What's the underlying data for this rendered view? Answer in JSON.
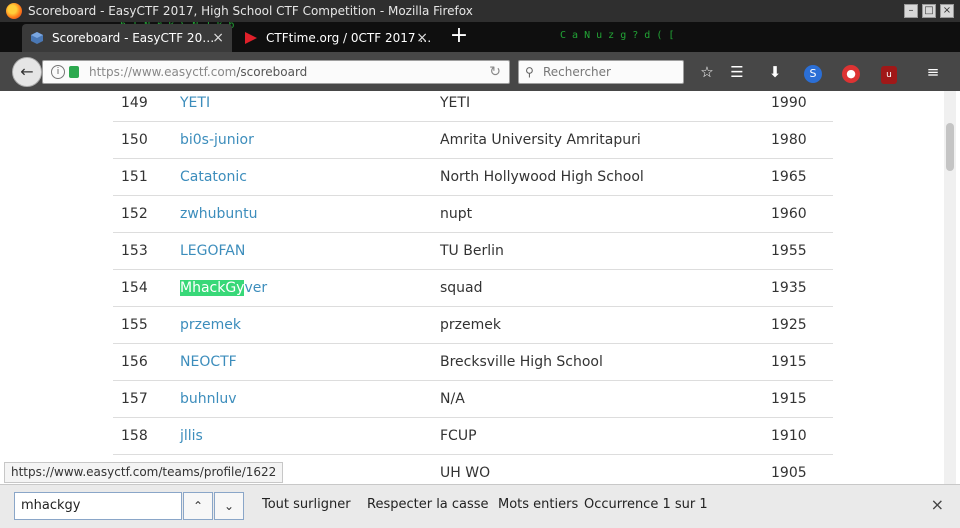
{
  "window": {
    "title": "Scoreboard - EasyCTF 2017, High School CTF Competition - Mozilla Firefox"
  },
  "tabs": [
    {
      "label": "Scoreboard - EasyCTF 20…",
      "active": true
    },
    {
      "label": "CTFtime.org / 0CTF 2017 …",
      "active": false
    }
  ],
  "nav": {
    "url_host": "https://www.easyctf.com",
    "url_path": "/scoreboard",
    "search_placeholder": "Rechercher"
  },
  "scoreboard": {
    "rows": [
      {
        "rank": "149",
        "team": "YETI",
        "school": "YETI",
        "score": "1990"
      },
      {
        "rank": "150",
        "team": "bi0s-junior",
        "school": "Amrita University Amritapuri",
        "score": "1980"
      },
      {
        "rank": "151",
        "team": "Catatonic",
        "school": "North Hollywood High School",
        "score": "1965"
      },
      {
        "rank": "152",
        "team": "zwhubuntu",
        "school": "nupt",
        "score": "1960"
      },
      {
        "rank": "153",
        "team": "LEGOFAN",
        "school": "TU Berlin",
        "score": "1955"
      },
      {
        "rank": "154",
        "team_highlight": "MhackGy",
        "team_rest": "ver",
        "school": "squad",
        "score": "1935"
      },
      {
        "rank": "155",
        "team": "przemek",
        "school": "przemek",
        "score": "1925"
      },
      {
        "rank": "156",
        "team": "NEOCTF",
        "school": "Brecksville High School",
        "score": "1915"
      },
      {
        "rank": "157",
        "team": "buhnluv",
        "school": "N/A",
        "score": "1915"
      },
      {
        "rank": "158",
        "team": "jllis",
        "school": "FCUP",
        "score": "1910"
      },
      {
        "rank": "",
        "team": "",
        "school": "UH WO",
        "score": "1905"
      }
    ]
  },
  "status_link": "https://www.easyctf.com/teams/profile/1622",
  "findbar": {
    "query": "mhackgy",
    "highlight_all": "Tout surligner",
    "match_case": "Respecter la casse",
    "whole_words": "Mots entiers",
    "occurrence": "Occurrence 1 sur 1"
  },
  "colors": {
    "link": "#3c8dbc",
    "highlight": "#38d878",
    "matrix": "#27c93f"
  }
}
